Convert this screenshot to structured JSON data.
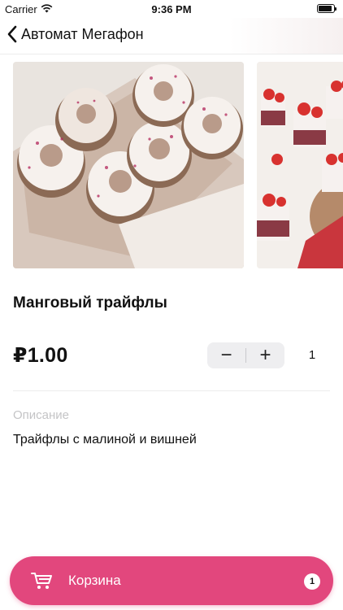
{
  "status_bar": {
    "carrier": "Carrier",
    "time": "9:36 PM"
  },
  "nav": {
    "title": "Автомат Мегафон"
  },
  "product": {
    "title": "Манговый трайфлы",
    "price": "₽1.00",
    "quantity": "1",
    "description_label": "Описание",
    "description": "Трайфлы с малиной и вишней"
  },
  "stepper": {
    "minus": "−",
    "plus": "+"
  },
  "cart": {
    "label": "Корзина",
    "count": "1"
  },
  "colors": {
    "accent": "#e2477d",
    "stepper_bg": "#eeeef0",
    "muted_text": "#c4c4c6"
  },
  "icons": {
    "back": "chevron-left-icon",
    "cart": "cart-icon",
    "wifi": "wifi-icon",
    "battery": "battery-icon"
  }
}
